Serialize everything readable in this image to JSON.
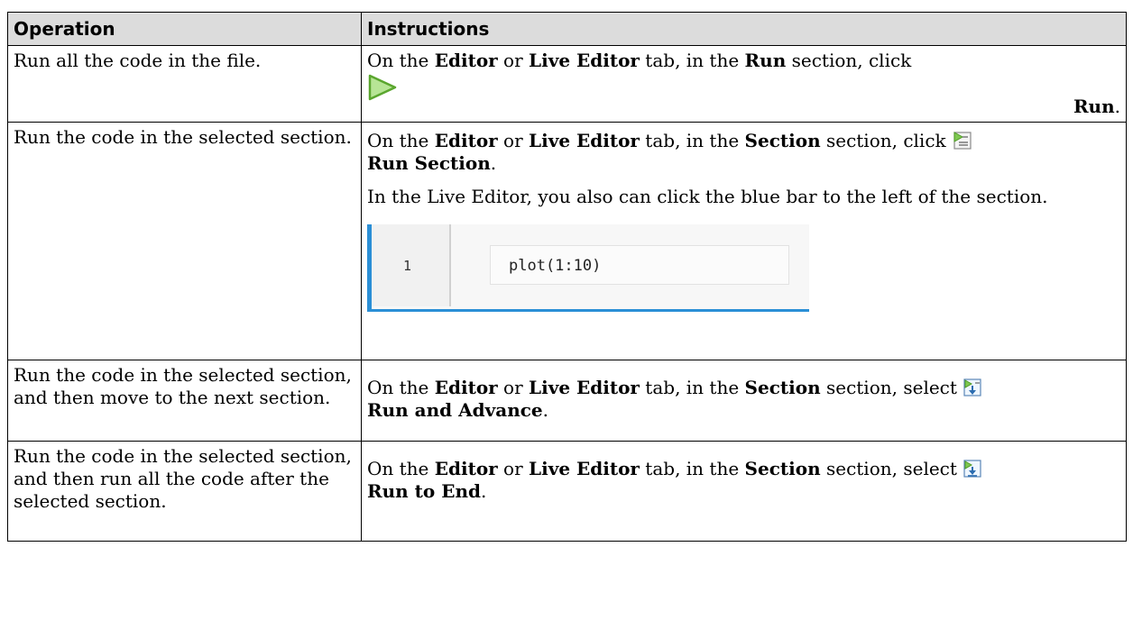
{
  "table": {
    "headers": [
      "Operation",
      "Instructions"
    ],
    "rows": [
      {
        "operation": "Run all the code in the file.",
        "i_on": "On the ",
        "i_editor": "Editor",
        "i_or": " or ",
        "i_live": "Live Editor",
        "i_tab": " tab, in the ",
        "i_section_name": "Run",
        "i_section_click": " section, click",
        "button_label": "Run",
        "end": ".",
        "icon": "green-run-triangle-icon"
      },
      {
        "operation": "Run the code in the selected section.",
        "i_on": "On the ",
        "i_editor": "Editor",
        "i_or": " or ",
        "i_live": "Live Editor",
        "i_tab": " tab, in the ",
        "i_section_name": "Section",
        "i_section_click": " section, click",
        "button_label": "Run Section",
        "end": ".",
        "note": "In the Live Editor, you also can click the blue bar to the left of the section.",
        "figure": {
          "line_number": "1",
          "code": "plot(1:10)"
        },
        "icon": "run-section-icon"
      },
      {
        "operation": "Run the code in the selected section, and then move to the next section.",
        "i_on": "On the ",
        "i_editor": "Editor",
        "i_or": " or ",
        "i_live": "Live Editor",
        "i_tab": " tab, in the ",
        "i_section_name": "Section",
        "i_section_click": " section, select",
        "button_label": "Run and Advance",
        "end": ".",
        "icon": "run-and-advance-icon"
      },
      {
        "operation": "Run the code in the selected section, and then run all the code after the selected section.",
        "i_on": "On the ",
        "i_editor": "Editor",
        "i_or": " or ",
        "i_live": "Live Editor",
        "i_tab": " tab, in the ",
        "i_section_name": "Section",
        "i_section_click": " section, select",
        "button_label": "Run to End",
        "end": ".",
        "icon": "run-to-end-icon"
      }
    ]
  },
  "colors": {
    "header_bg": "#dcdcdc",
    "accent_blue": "#2b8fd6",
    "run_green": "#7ec850"
  }
}
